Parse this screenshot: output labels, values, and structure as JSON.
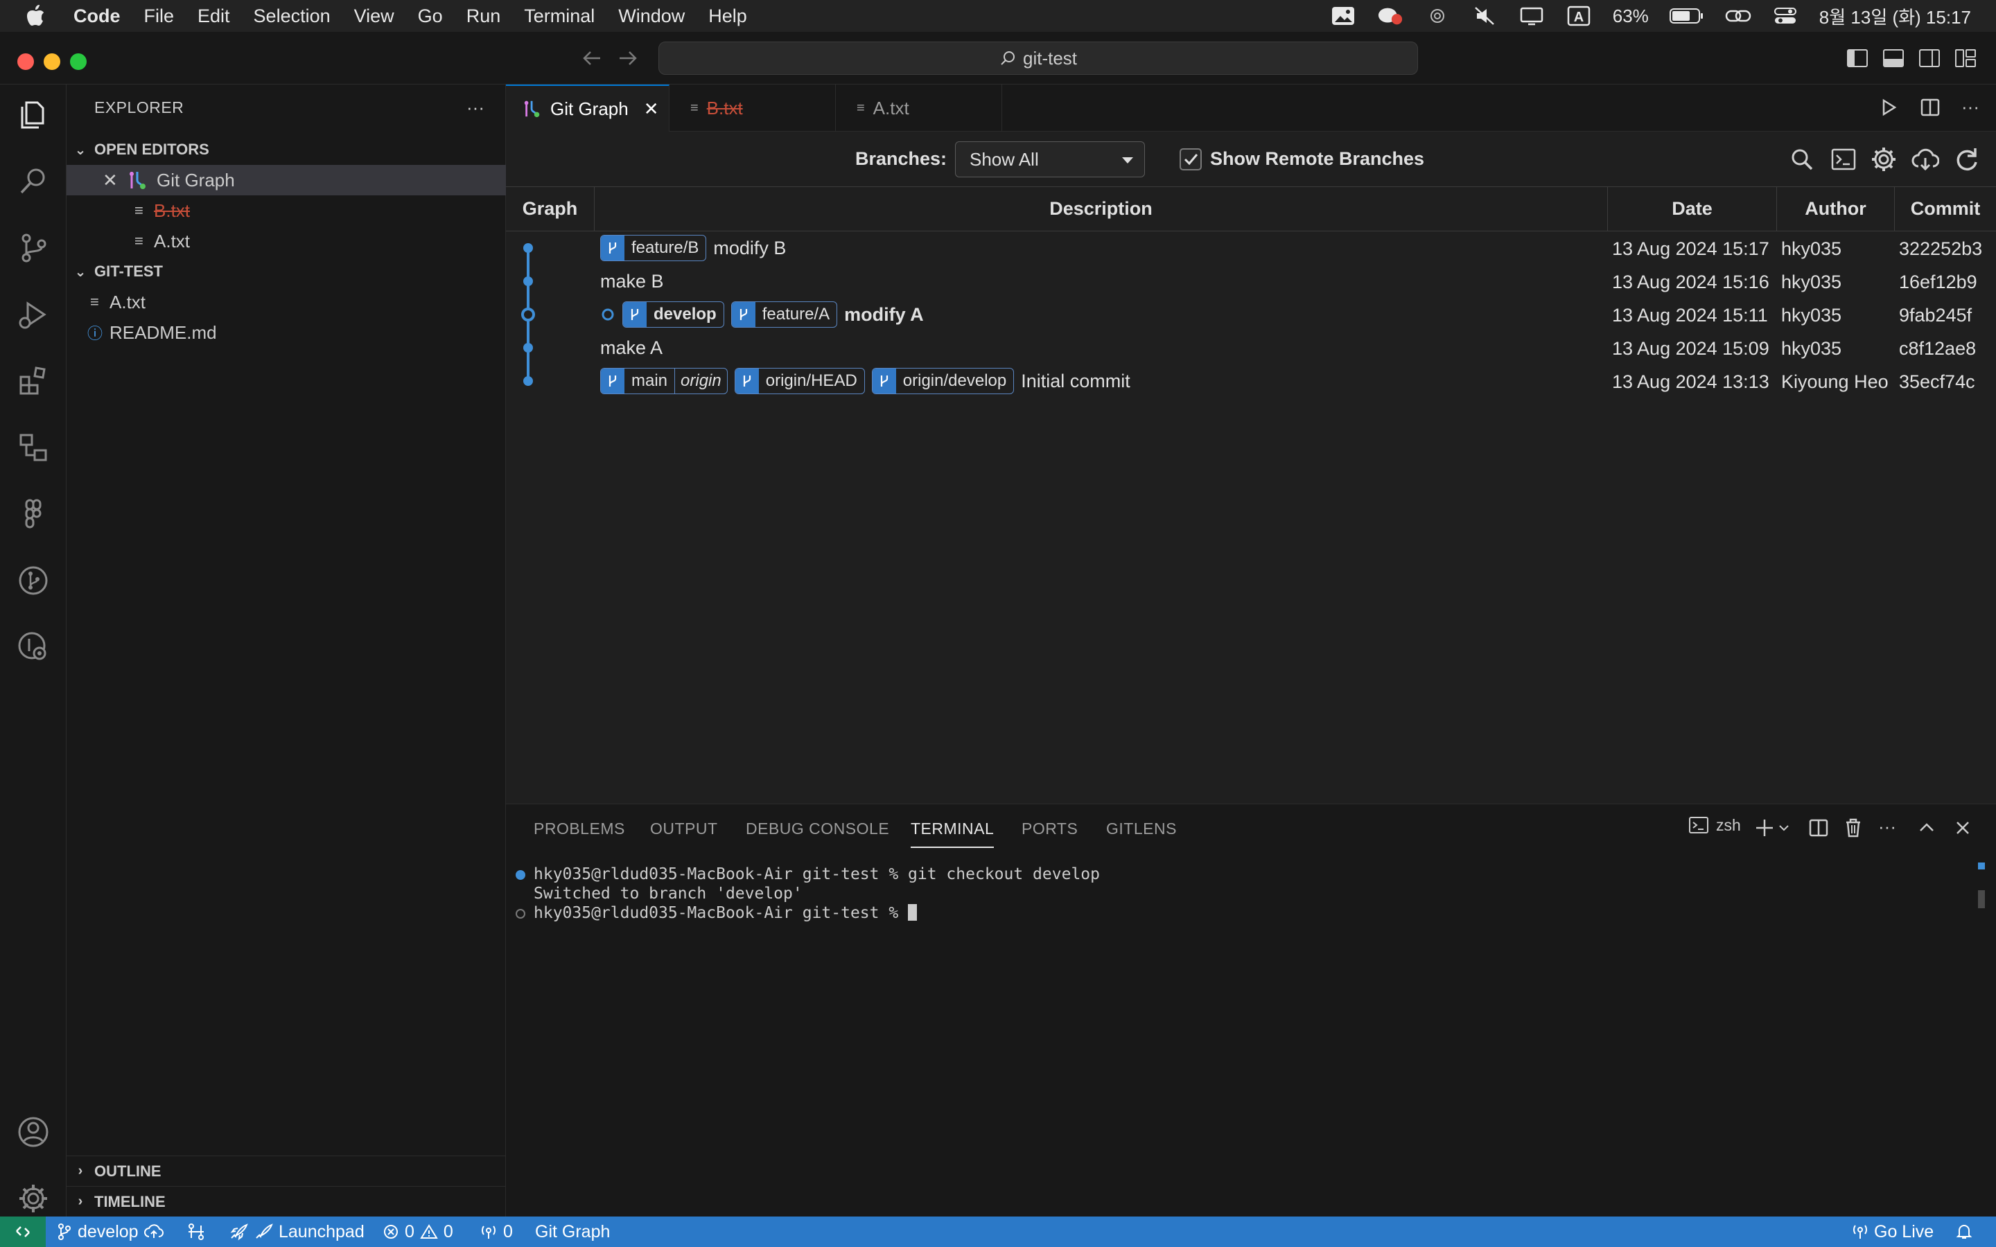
{
  "menubar": {
    "items": [
      "Code",
      "File",
      "Edit",
      "Selection",
      "View",
      "Go",
      "Run",
      "Terminal",
      "Window",
      "Help"
    ],
    "battery": "63%",
    "datetime": "8월 13일 (화) 15:17"
  },
  "titlebar": {
    "search_text": "git-test"
  },
  "sidebar": {
    "title": "EXPLORER",
    "open_editors_label": "OPEN EDITORS",
    "open_editors": [
      "Git Graph",
      "B.txt",
      "A.txt"
    ],
    "workspace_label": "GIT-TEST",
    "files": [
      "A.txt",
      "README.md"
    ],
    "outline_label": "OUTLINE",
    "timeline_label": "TIMELINE"
  },
  "tabs": [
    "Git Graph",
    "B.txt",
    "A.txt"
  ],
  "git_graph": {
    "branches_label": "Branches:",
    "branches_value": "Show All",
    "show_remote_label": "Show Remote Branches",
    "show_remote_checked": true,
    "columns": [
      "Graph",
      "Description",
      "Date",
      "Author",
      "Commit"
    ],
    "commits": [
      {
        "refs": [
          {
            "name": "feature/B"
          }
        ],
        "message": "modify B",
        "date": "13 Aug 2024 15:17",
        "author": "hky035",
        "hash": "322252b3"
      },
      {
        "refs": [],
        "message": "make B",
        "date": "13 Aug 2024 15:16",
        "author": "hky035",
        "hash": "16ef12b9"
      },
      {
        "refs": [
          {
            "name": "develop",
            "head": true
          },
          {
            "name": "feature/A"
          }
        ],
        "message": "modify A",
        "date": "13 Aug 2024 15:11",
        "author": "hky035",
        "hash": "9fab245f"
      },
      {
        "refs": [],
        "message": "make A",
        "date": "13 Aug 2024 15:09",
        "author": "hky035",
        "hash": "c8f12ae8"
      },
      {
        "refs": [
          {
            "name": "main",
            "remote": "origin"
          },
          {
            "name": "origin/HEAD"
          },
          {
            "name": "origin/develop"
          }
        ],
        "message": "Initial commit",
        "date": "13 Aug 2024 13:13",
        "author": "Kiyoung Heo",
        "hash": "35ecf74c"
      }
    ],
    "graph_color": "#3f8fd8"
  },
  "panel": {
    "tabs": [
      "PROBLEMS",
      "OUTPUT",
      "DEBUG CONSOLE",
      "TERMINAL",
      "PORTS",
      "GITLENS"
    ],
    "active_tab": "TERMINAL",
    "shell": "zsh",
    "terminal_lines": [
      "hky035@rldud035-MacBook-Air git-test % git checkout develop",
      "Switched to branch 'develop'",
      "hky035@rldud035-MacBook-Air git-test % "
    ]
  },
  "statusbar": {
    "branch": "develop",
    "launchpad": "Launchpad",
    "errors": "0",
    "warnings": "0",
    "ports": "0",
    "git_graph": "Git Graph",
    "go_live": "Go Live"
  },
  "colors": {
    "accent": "#0078d4",
    "statusbar": "#2b79c8",
    "remote": "#16825d",
    "deleted": "#c74e39"
  }
}
